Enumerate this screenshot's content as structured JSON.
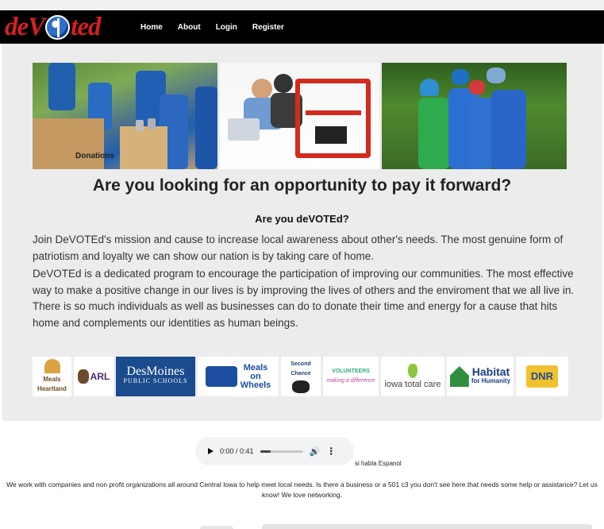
{
  "brand": {
    "logo_text": "deVOTed",
    "logo_left": "deV",
    "logo_right": "ted"
  },
  "nav": {
    "items": [
      {
        "label": "Home"
      },
      {
        "label": "About"
      },
      {
        "label": "Login"
      },
      {
        "label": "Register"
      }
    ]
  },
  "hero": {
    "headline": "Are you looking for an opportunity to pay it forward?",
    "subheadline": "Are you deVOTEd?",
    "paragraph1": "Join DeVOTEd's mission and cause to increase local awareness about other's needs. The most genuine form of patriotism and loyalty we can show our nation is by taking care of home.",
    "paragraph2": "DeVOTEd is a dedicated program to encourage the participation of improving our communities. The most effective way to make a positive change in our lives is by improving the lives of others and the enviroment that we all live in. There is so much individuals as well as businesses can do to donate their time and energy for a cause that hits home and complements our identities as human beings.",
    "photo1_label": "Donations"
  },
  "partners": [
    {
      "name": "Meals from the Heartland",
      "line1": "Meals",
      "line2": "Heartland"
    },
    {
      "name": "ARL",
      "line1": "ARL"
    },
    {
      "name": "Des Moines Public Schools",
      "line1": "DesMoines",
      "line2": "PUBLIC SCHOOLS"
    },
    {
      "name": "Meals on Wheels",
      "line1": "Meals",
      "line2": "on",
      "line3": "Wheels"
    },
    {
      "name": "Second Chance",
      "line1": "Second",
      "line2": "Chance"
    },
    {
      "name": "Volunteers",
      "line1": "VOLUNTEERS",
      "line2": "making a difference"
    },
    {
      "name": "iowa total care",
      "line1": "iowa total care"
    },
    {
      "name": "Habitat for Humanity",
      "line1": "Habitat",
      "line2": "for Humanity"
    },
    {
      "name": "DNR",
      "line1": "DNR"
    }
  ],
  "audio": {
    "time": "0:00 / 0:41",
    "progress": 0.0
  },
  "habla": "si habla Espanol",
  "networking": "We work with companies and non profit organizations all around Central Iowa to help meet local needs. Is there a business or a 501 c3 you don't see here that needs some help or assistance? Let us know! We love networking.",
  "colors": {
    "brand_red": "#d6201f",
    "navbar": "#000000",
    "panel": "#ececec",
    "dmps_blue": "#1a4b8c"
  }
}
